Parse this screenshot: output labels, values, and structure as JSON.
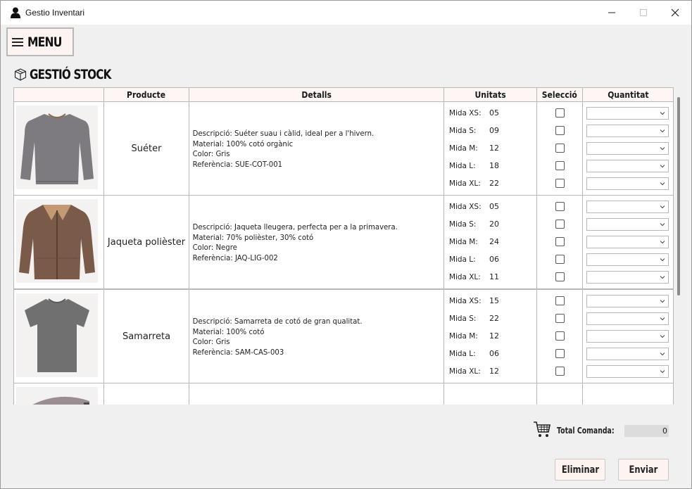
{
  "window": {
    "title": "Gestio Inventari",
    "icon": "user-icon",
    "controls": [
      "minimize-icon",
      "maximize-icon",
      "close-icon"
    ]
  },
  "menu": {
    "label": "MENU",
    "icon": "hamburger-icon"
  },
  "section": {
    "title": "GESTIÓ STOCK",
    "icon": "box-icon"
  },
  "table": {
    "headers": [
      "",
      "Producte",
      "Detalls",
      "Unitats",
      "Selecció",
      "Quantitat"
    ],
    "size_labels": [
      "Mida XS:",
      "Mida S:",
      "Mida M:",
      "Mida L:",
      "Mida XL:"
    ],
    "rows": [
      {
        "name": "Suéter",
        "image": "sweater-image",
        "details": [
          "Descripció: Suéter suau i càlid, ideal per a l'hivern.",
          "Material: 100% cotó orgànic",
          "Color: Gris",
          "Referència: SUE-COT-001"
        ],
        "units": [
          "05",
          "09",
          "12",
          "18",
          "22"
        ]
      },
      {
        "name": "Jaqueta polièster",
        "image": "jacket-image",
        "details": [
          "Descripció: Jaqueta lleugera, perfecta per a la primavera.",
          "Material: 70% polièster, 30% cotó",
          "Color: Negre",
          "Referència: JAQ-LIG-002"
        ],
        "units": [
          "05",
          "20",
          "24",
          "06",
          "11"
        ]
      },
      {
        "name": "Samarreta",
        "image": "tshirt-image",
        "details": [
          "Descripció: Samarreta de cotó de gran qualitat.",
          "Material: 100% cotó",
          "Color: Gris",
          "Referència: SAM-CAS-003"
        ],
        "units": [
          "15",
          "22",
          "12",
          "06",
          "12"
        ]
      }
    ]
  },
  "footer": {
    "total_label": "Total Comanda:",
    "total_value": "0",
    "cart_icon": "cart-icon",
    "buttons": {
      "delete": "Eliminar",
      "send": "Enviar"
    }
  }
}
